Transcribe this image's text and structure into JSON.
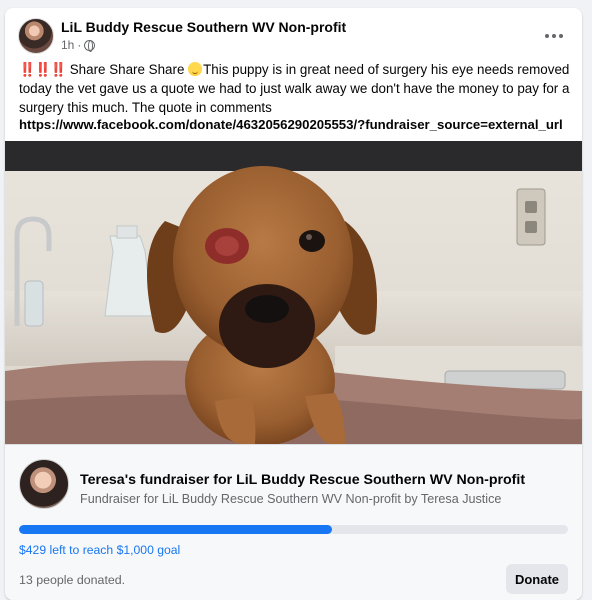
{
  "post": {
    "author": "LiL Buddy Rescue Southern WV Non-profit",
    "time": "1h",
    "separator": "·",
    "bangs": "‼️‼️‼️",
    "text_before_emoji": " Share Share Share ",
    "text_after_emoji": "This puppy is in great need of surgery his eye needs removed today the vet gave us a quote we had to just walk away we don't have the money to pay for a surgery this much.     The quote in comments",
    "link": "https://www.facebook.com/donate/4632056290205553/?fundraiser_source=external_url"
  },
  "icons": {
    "more": "more-options-icon",
    "privacy": "globe-icon",
    "emoji": "flushed-face-emoji"
  },
  "fundraiser": {
    "title": "Teresa's fundraiser for LiL Buddy Rescue Southern WV Non-profit",
    "subtitle": "Fundraiser for LiL Buddy Rescue Southern WV Non-profit by Teresa Justice",
    "progress_fraction": 0.571,
    "goal_text": "$429 left to reach $1,000 goal",
    "donors_text": "13 people donated.",
    "donate_label": "Donate"
  },
  "colors": {
    "accent": "#1877f2",
    "secondary_text": "#65676b",
    "card_bg": "#f7f8fa",
    "button_bg": "#e4e6eb"
  }
}
